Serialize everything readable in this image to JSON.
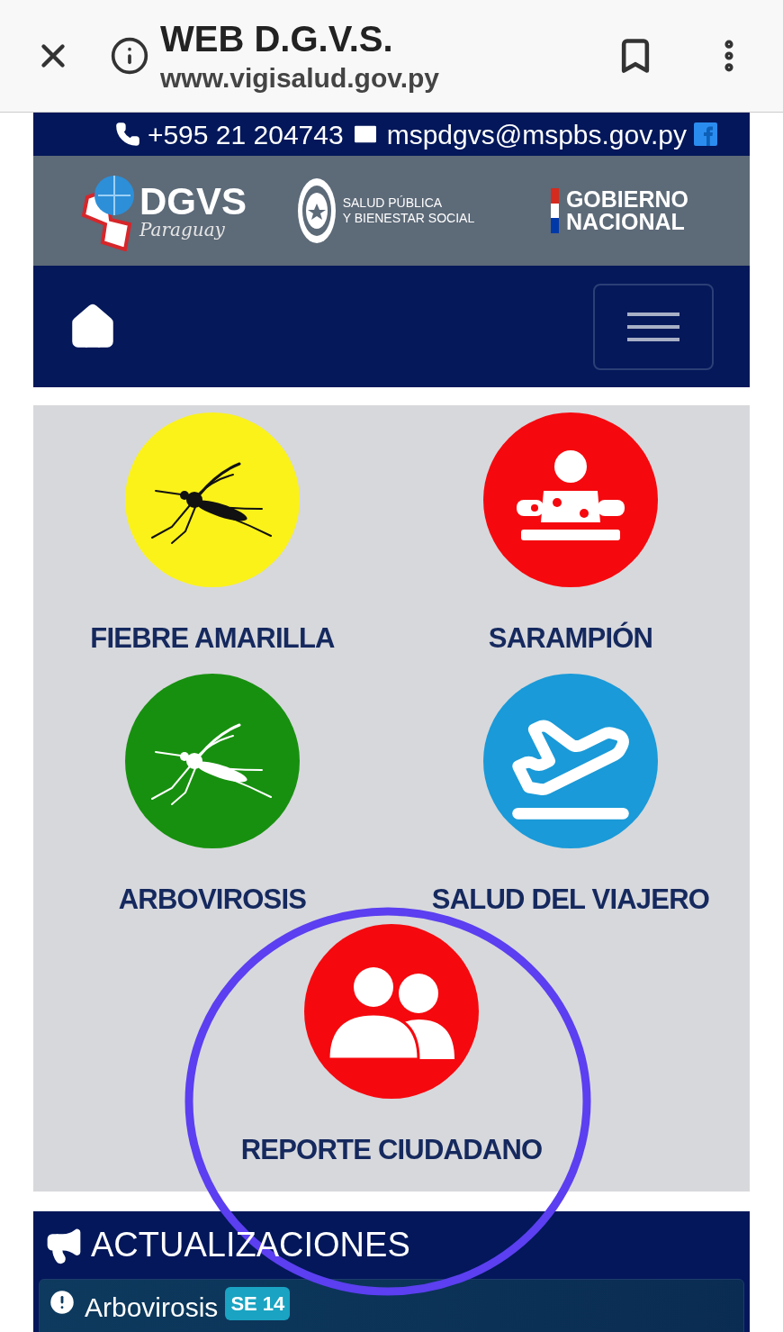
{
  "browser": {
    "title": "WEB D.G.V.S.",
    "url": "www.vigisalud.gov.py"
  },
  "contact": {
    "phone": "+595 21 204743",
    "email": "mspdgvs@mspbs.gov.py"
  },
  "logos": {
    "dgvs": {
      "name": "DGVS",
      "script": "Paraguay"
    },
    "ministry": [
      "SALUD PÚBLICA",
      "Y BIENESTAR SOCIAL"
    ],
    "government": [
      "GOBIERNO",
      "NACIONAL"
    ]
  },
  "tiles": [
    {
      "label": "FIEBRE AMARILLA",
      "color": "#fbf21a",
      "kind": "mosquito"
    },
    {
      "label": "SARAMPIÓN",
      "color": "#f5090e",
      "kind": "rash"
    },
    {
      "label": "ARBOVIROSIS",
      "color": "#17900f",
      "kind": "mosquito"
    },
    {
      "label": "SALUD DEL VIAJERO",
      "color": "#1a9ad8",
      "kind": "plane"
    },
    {
      "label": "REPORTE CIUDADANO",
      "color": "#f5090e",
      "kind": "people"
    }
  ],
  "updates": {
    "title": "ACTUALIZACIONES",
    "items": [
      {
        "label": "Arbovirosis",
        "badge": "SE 14"
      }
    ]
  }
}
